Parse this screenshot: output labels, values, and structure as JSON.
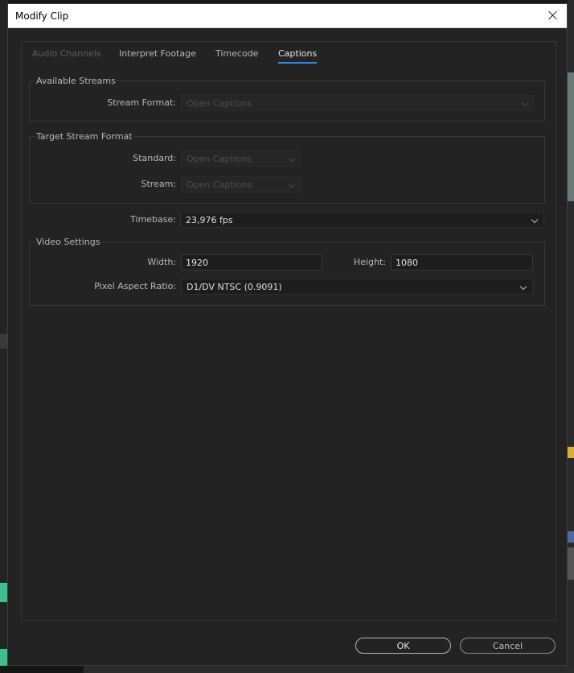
{
  "dialog": {
    "title": "Modify Clip"
  },
  "tabs": [
    {
      "label": "Audio Channels",
      "state": "disabled"
    },
    {
      "label": "Interpret Footage",
      "state": "normal"
    },
    {
      "label": "Timecode",
      "state": "normal"
    },
    {
      "label": "Captions",
      "state": "active"
    }
  ],
  "available_streams": {
    "legend": "Available Streams",
    "stream_format_label": "Stream Format:",
    "stream_format_value": "Open Captions"
  },
  "target_stream": {
    "legend": "Target Stream Format",
    "standard_label": "Standard:",
    "standard_value": "Open Captions",
    "stream_label": "Stream:",
    "stream_value": "Open Captions"
  },
  "timebase": {
    "label": "Timebase:",
    "value": "23,976 fps"
  },
  "video_settings": {
    "legend": "Video Settings",
    "width_label": "Width:",
    "width_value": "1920",
    "height_label": "Height:",
    "height_value": "1080",
    "par_label": "Pixel Aspect Ratio:",
    "par_value": "D1/DV NTSC (0.9091)"
  },
  "buttons": {
    "ok": "OK",
    "cancel": "Cancel"
  },
  "colors": {
    "accent_tab_underline": "#2d8ceb",
    "dialog_bg": "#232323",
    "titlebar_bg": "#ffffff"
  }
}
